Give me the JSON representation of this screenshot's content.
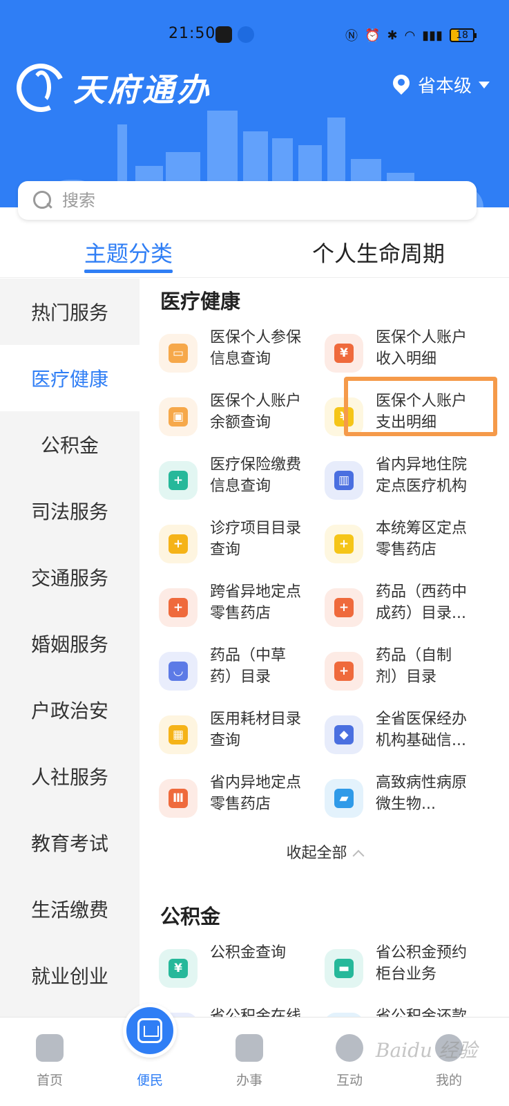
{
  "status_bar": {
    "time": "21:50",
    "battery": "18"
  },
  "header": {
    "app_title": "天府通办",
    "location": "省本级"
  },
  "search": {
    "placeholder": "搜索"
  },
  "tabs": [
    {
      "label": "主题分类"
    },
    {
      "label": "个人生命周期"
    }
  ],
  "sidebar": {
    "items": [
      {
        "label": "热门服务"
      },
      {
        "label": "医疗健康"
      },
      {
        "label": "公积金"
      },
      {
        "label": "司法服务"
      },
      {
        "label": "交通服务"
      },
      {
        "label": "婚姻服务"
      },
      {
        "label": "户政治安"
      },
      {
        "label": "人社服务"
      },
      {
        "label": "教育考试"
      },
      {
        "label": "生活缴费"
      },
      {
        "label": "就业创业"
      }
    ]
  },
  "sections": [
    {
      "title": "医疗健康",
      "items": [
        {
          "line1": "医保个人参保",
          "line2": "信息查询",
          "icon": "id-card-icon",
          "color": "#f6a84a"
        },
        {
          "line1": "医保个人账户",
          "line2": "收入明细",
          "icon": "yuan-bill-icon",
          "color": "#ef6a3c"
        },
        {
          "line1": "医保个人账户",
          "line2": "余额查询",
          "icon": "badge-icon",
          "color": "#f6a84a"
        },
        {
          "line1": "医保个人账户",
          "line2": "支出明细",
          "icon": "house-yuan-icon",
          "color": "#f5c518"
        },
        {
          "line1": "医疗保险缴费",
          "line2": "信息查询",
          "icon": "medical-house-icon",
          "color": "#26b89a"
        },
        {
          "line1": "省内异地住院",
          "line2": "定点医疗机构",
          "icon": "hospital-building-icon",
          "color": "#4a6fe0"
        },
        {
          "line1": "诊疗项目目录",
          "line2": "查询",
          "icon": "medical-cross-icon",
          "color": "#f5b318"
        },
        {
          "line1": "本统筹区定点",
          "line2": "零售药店",
          "icon": "medicine-bottle-icon",
          "color": "#f5c518"
        },
        {
          "line1": "跨省异地定点",
          "line2": "零售药店",
          "icon": "pharmacy-store-icon",
          "color": "#ef6a3c"
        },
        {
          "line1": "药品（西药中",
          "line2": "成药）目录...",
          "icon": "medicine-jar-icon",
          "color": "#ef6a3c"
        },
        {
          "line1": "药品（中草",
          "line2": "药）目录",
          "icon": "herbal-bowl-icon",
          "color": "#5c7ae6"
        },
        {
          "line1": "药品（自制",
          "line2": "剂）目录",
          "icon": "medicine-jar-icon",
          "color": "#ef6a3c"
        },
        {
          "line1": "医用耗材目录",
          "line2": "查询",
          "icon": "supply-store-icon",
          "color": "#f5b318"
        },
        {
          "line1": "全省医保经办",
          "line2": "机构基础信...",
          "icon": "map-pin-icon",
          "color": "#4a6fe0"
        },
        {
          "line1": "省内异地定点",
          "line2": "零售药店",
          "icon": "institution-icon",
          "color": "#ef6a3c"
        },
        {
          "line1": "高致病性病原",
          "line2": "微生物...",
          "icon": "truck-icon",
          "color": "#2f9ae8"
        }
      ],
      "collapse_label": "收起全部"
    },
    {
      "title": "公积金",
      "items": [
        {
          "line1": "公积金查询",
          "line2": "",
          "icon": "house-yuan-icon",
          "color": "#26b89a"
        },
        {
          "line1": "省公积金预约",
          "line2": "柜台业务",
          "icon": "counter-icon",
          "color": "#26b89a"
        },
        {
          "line1": "省公积金在线",
          "line2": "",
          "icon": "online-icon",
          "color": "#5c7ae6"
        },
        {
          "line1": "省公积金还款",
          "line2": "",
          "icon": "repay-icon",
          "color": "#2f9ae8"
        }
      ]
    }
  ],
  "bottom_nav": [
    {
      "label": "首页",
      "icon": "home-icon"
    },
    {
      "label": "便民",
      "icon": "service-icon"
    },
    {
      "label": "办事",
      "icon": "document-icon"
    },
    {
      "label": "互动",
      "icon": "interact-icon"
    },
    {
      "label": "我的",
      "icon": "profile-icon"
    }
  ],
  "watermark": "Baidu 经验",
  "colors": {
    "primary": "#2f7ef5",
    "highlight": "#f59a4a",
    "sidebar_bg": "#f4f4f4"
  }
}
